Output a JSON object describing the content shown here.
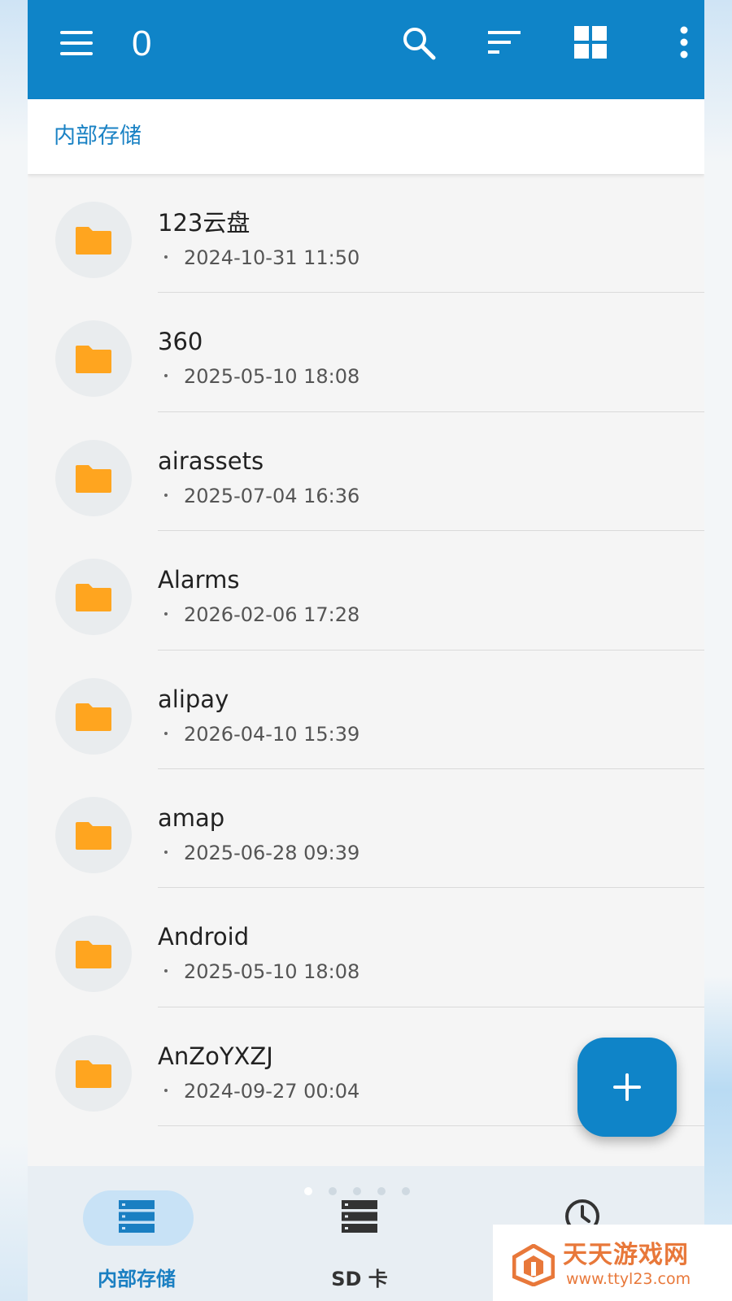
{
  "toolbar": {
    "title": "0",
    "icons": [
      "menu-icon",
      "search-icon",
      "sort-icon",
      "grid-view-icon",
      "more-vert-icon"
    ],
    "background": "#0f84c8"
  },
  "breadcrumb": {
    "current": "内部存储"
  },
  "files": [
    {
      "name": "123云盘",
      "date": "2024-10-31 11:50"
    },
    {
      "name": "360",
      "date": "2025-05-10 18:08"
    },
    {
      "name": "airassets",
      "date": "2025-07-04 16:36"
    },
    {
      "name": "Alarms",
      "date": "2026-02-06 17:28"
    },
    {
      "name": "alipay",
      "date": "2026-04-10 15:39"
    },
    {
      "name": "amap",
      "date": "2025-06-28 09:39"
    },
    {
      "name": "Android",
      "date": "2025-05-10 18:08"
    },
    {
      "name": "AnZoYXZJ",
      "date": "2024-09-27 00:04"
    }
  ],
  "date_prefix": "·",
  "fab": {
    "icon": "plus-icon"
  },
  "bottom_nav": {
    "items": [
      {
        "label": "内部存储",
        "icon": "storage-icon",
        "selected": true
      },
      {
        "label": "SD 卡",
        "icon": "sd-storage-icon",
        "selected": false
      },
      {
        "label": "",
        "icon": "clock-icon",
        "selected": false
      }
    ]
  },
  "watermark": {
    "title": "天天游戏网",
    "url": "www.ttyl23.com"
  },
  "colors": {
    "accent": "#0f84c8",
    "folder": "#ffa51f",
    "watermark": "#e8783a"
  }
}
